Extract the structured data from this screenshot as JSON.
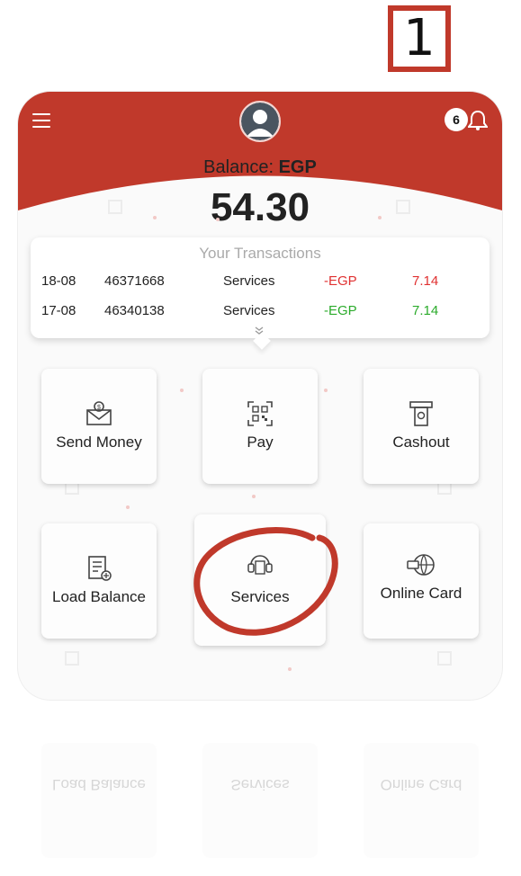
{
  "annotation": {
    "step_number": "1"
  },
  "header": {
    "menu_icon": "hamburger-menu-icon",
    "avatar_icon": "user-avatar-icon",
    "notification_count": "6",
    "bell_icon": "bell-icon",
    "balance_label": "Balance:",
    "balance_currency": "EGP",
    "balance_amount": "54.30"
  },
  "transactions": {
    "title": "Your Transactions",
    "rows": [
      {
        "date": "18-08",
        "id": "46371668",
        "type": "Services",
        "currency": "-EGP",
        "amount": "7.14",
        "status_color": "#e03131"
      },
      {
        "date": "17-08",
        "id": "46340138",
        "type": "Services",
        "currency": "-EGP",
        "amount": "7.14",
        "status_color": "#2bab2b"
      }
    ],
    "expand_icon": "double-chevron-down-icon"
  },
  "actions": [
    {
      "label": "Send Money",
      "icon": "envelope-money-icon"
    },
    {
      "label": "Pay",
      "icon": "qr-code-icon"
    },
    {
      "label": "Cashout",
      "icon": "atm-cashout-icon"
    },
    {
      "label": "Load Balance",
      "icon": "load-balance-icon"
    },
    {
      "label": "Services",
      "icon": "services-icon"
    },
    {
      "label": "Online Card",
      "icon": "online-card-icon"
    }
  ],
  "reflection_labels": [
    "Load Balance",
    "Services",
    "Online Card"
  ],
  "colors": {
    "brand_red": "#c0392b",
    "negative": "#e03131",
    "positive": "#2bab2b"
  }
}
